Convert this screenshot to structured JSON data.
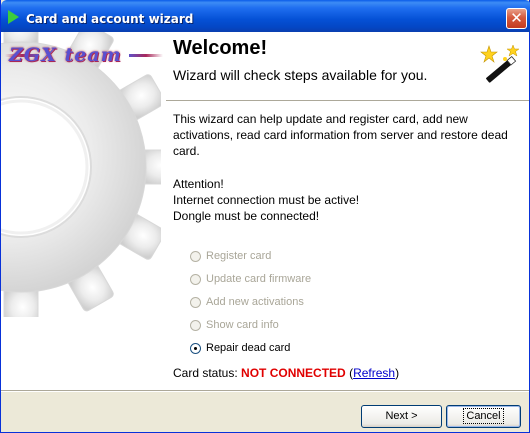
{
  "window": {
    "title": "Card and account wizard",
    "close_glyph": "✕"
  },
  "logo": {
    "text": "ZGX team"
  },
  "header": {
    "title": "Welcome!",
    "subtitle": "Wizard will check steps available for you."
  },
  "body": {
    "description": "This wizard can help update and register card, add new activations, read card information from server and restore dead card.",
    "attention_title": "Attention!",
    "attention_line1": "Internet connection must be active!",
    "attention_line2": "Dongle must be connected!"
  },
  "options": [
    {
      "label": "Register card",
      "enabled": false,
      "selected": false
    },
    {
      "label": "Update card firmware",
      "enabled": false,
      "selected": false
    },
    {
      "label": "Add new activations",
      "enabled": false,
      "selected": false
    },
    {
      "label": "Show card info",
      "enabled": false,
      "selected": false
    },
    {
      "label": "Repair dead card",
      "enabled": true,
      "selected": true
    }
  ],
  "status": {
    "label": "Card status:",
    "value": "NOT CONNECTED",
    "open_paren": "(",
    "refresh_link": "Refresh",
    "close_paren": ")"
  },
  "buttons": {
    "next": "Next >",
    "cancel": "Cancel"
  },
  "colors": {
    "titlebar": "#0551d6",
    "status_error": "#e00000",
    "link": "#0000cc"
  },
  "icons": {
    "title": "play-arrow-icon",
    "wizard": "magic-wand-icon",
    "background": "gear-icon"
  }
}
